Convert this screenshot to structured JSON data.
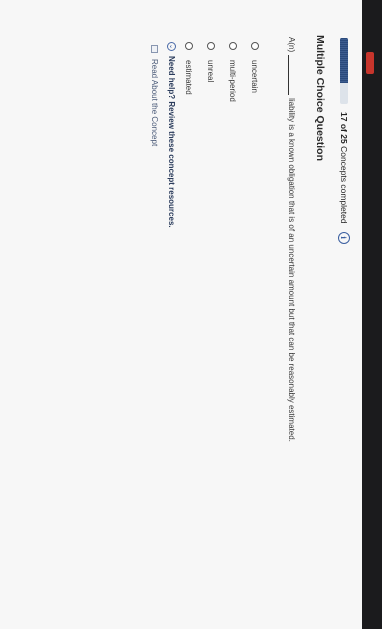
{
  "progress": {
    "completed": "17",
    "total": "25",
    "text_of": "of",
    "text_suffix": "Concepts completed",
    "fraction": 0.68,
    "info_symbol": "i"
  },
  "question": {
    "type_title": "Multiple Choice Question",
    "stem_prefix": "A(n)",
    "stem_rest": "liability is a known obligation that is of an uncertain amount but that can be reasonably estimated.",
    "options": [
      "uncertain",
      "multi-period",
      "unreal",
      "estimated"
    ]
  },
  "help": {
    "title": "Need help? Review these concept resources.",
    "resource_label": "Read About the Concept"
  },
  "colors": {
    "progress_fill": "#2f4f80",
    "accent": "#3b5fa0",
    "edge": "#1b1b1d",
    "tab": "#c7352c"
  }
}
